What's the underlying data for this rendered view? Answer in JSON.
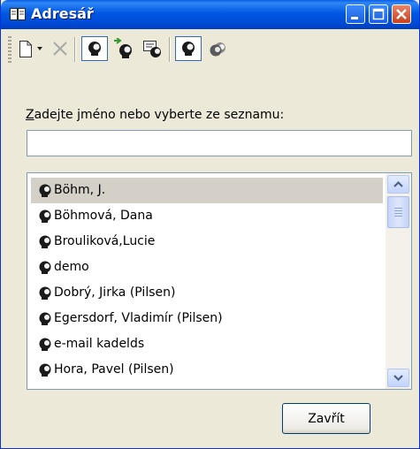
{
  "window": {
    "title": "Adresář",
    "title_icon": "address-book-icon",
    "controls": [
      "minimize-icon",
      "maximize-icon",
      "close-icon"
    ]
  },
  "toolbar": {
    "items": [
      {
        "name": "new-contact",
        "icon": "new-document-icon"
      },
      {
        "name": "new-dropdown",
        "icon": "dropdown-arrow-icon"
      },
      {
        "name": "delete",
        "icon": "delete-x-icon",
        "disabled": true
      },
      {
        "name": "contact-view",
        "icon": "person-icon",
        "pressed": true
      },
      {
        "name": "add-to-contact",
        "icon": "person-arrow-icon"
      },
      {
        "name": "contact-properties",
        "icon": "person-card-icon"
      },
      {
        "name": "contacts-view",
        "icon": "person-icon",
        "pressed": true
      },
      {
        "name": "groups-view",
        "icon": "group-icon"
      }
    ]
  },
  "search": {
    "label_accesskey": "Z",
    "label_rest": "adejte jméno nebo vyberte ze seznamu:",
    "value": ""
  },
  "contacts": [
    {
      "name": "Böhm, J.",
      "selected": true
    },
    {
      "name": "Böhmová, Dana"
    },
    {
      "name": "Brouliková,Lucie"
    },
    {
      "name": "demo"
    },
    {
      "name": "Dobrý, Jirka (Pilsen)"
    },
    {
      "name": "Egersdorf, Vladimír (Pilsen)"
    },
    {
      "name": "e-mail kadelds"
    },
    {
      "name": "Hora, Pavel (Pilsen)"
    }
  ],
  "buttons": {
    "close_label": "Zavřít"
  },
  "colors": {
    "titlebar": "#0058e3",
    "face": "#ece9d8",
    "selection": "#d4d0c8",
    "field_border": "#7f9db9"
  }
}
